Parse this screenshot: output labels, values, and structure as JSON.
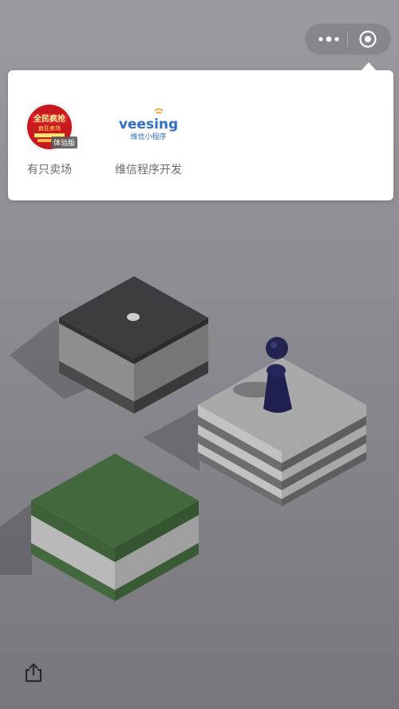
{
  "menu_capsule": {
    "more_icon": "more-dots-icon",
    "close_icon": "close-miniprogram-icon"
  },
  "recent_apps": [
    {
      "name": "有只卖场",
      "icon": "sale-store-icon",
      "icon_text_main": "全民疯抢",
      "icon_text_sub": "疯狂卖场",
      "icon_badge": "体验版"
    },
    {
      "name": "维信程序开发",
      "icon": "veesing-logo-icon",
      "logo_text": "veesing",
      "logo_sub": "维信小程序"
    }
  ],
  "game": {
    "scene": "jump-game",
    "player_color": "#1e1f4a",
    "platform_colors": [
      "#3d3d3d",
      "#cfcfcf",
      "#4a6b42"
    ]
  },
  "share_button": {
    "icon": "share-icon"
  }
}
